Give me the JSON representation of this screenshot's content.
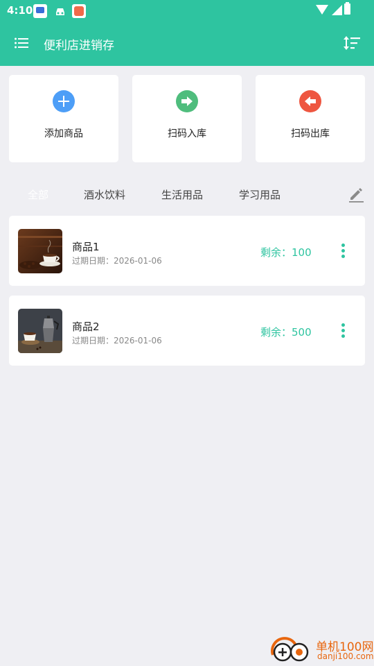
{
  "status_bar": {
    "time": "4:10",
    "icons": [
      "app-notification-icon",
      "car-notification-icon",
      "health-notification-icon",
      "wifi-icon",
      "cellular-signal-icon",
      "battery-icon"
    ]
  },
  "app_bar": {
    "title": "便利店进销存",
    "menu_icon": "menu-icon",
    "sort_icon": "sort-icon",
    "color": "#2ec4a0"
  },
  "actions": [
    {
      "label": "添加商品",
      "icon": "add-icon",
      "color": "#4d9ef7"
    },
    {
      "label": "扫码入库",
      "icon": "scan-in-icon",
      "color": "#4fbd7d"
    },
    {
      "label": "扫码出库",
      "icon": "scan-out-icon",
      "color": "#ee5640"
    }
  ],
  "tabs": {
    "items": [
      "全部",
      "酒水饮料",
      "生活用品",
      "学习用品"
    ],
    "active": "全部",
    "edit_icon": "edit-icon"
  },
  "products": [
    {
      "name": "商品1",
      "expiry_label": "过期日期：",
      "expiry_date": "2026-01-06",
      "stock_label": "剩余：",
      "stock": "100",
      "thumb": "coffee-cup-photo"
    },
    {
      "name": "商品2",
      "expiry_label": "过期日期：",
      "expiry_date": "2026-01-06",
      "stock_label": "剩余：",
      "stock": "500",
      "thumb": "moka-pot-coffee-photo"
    }
  ],
  "watermark": {
    "text_cn": "单机100网",
    "text_en": "danji100.com"
  }
}
